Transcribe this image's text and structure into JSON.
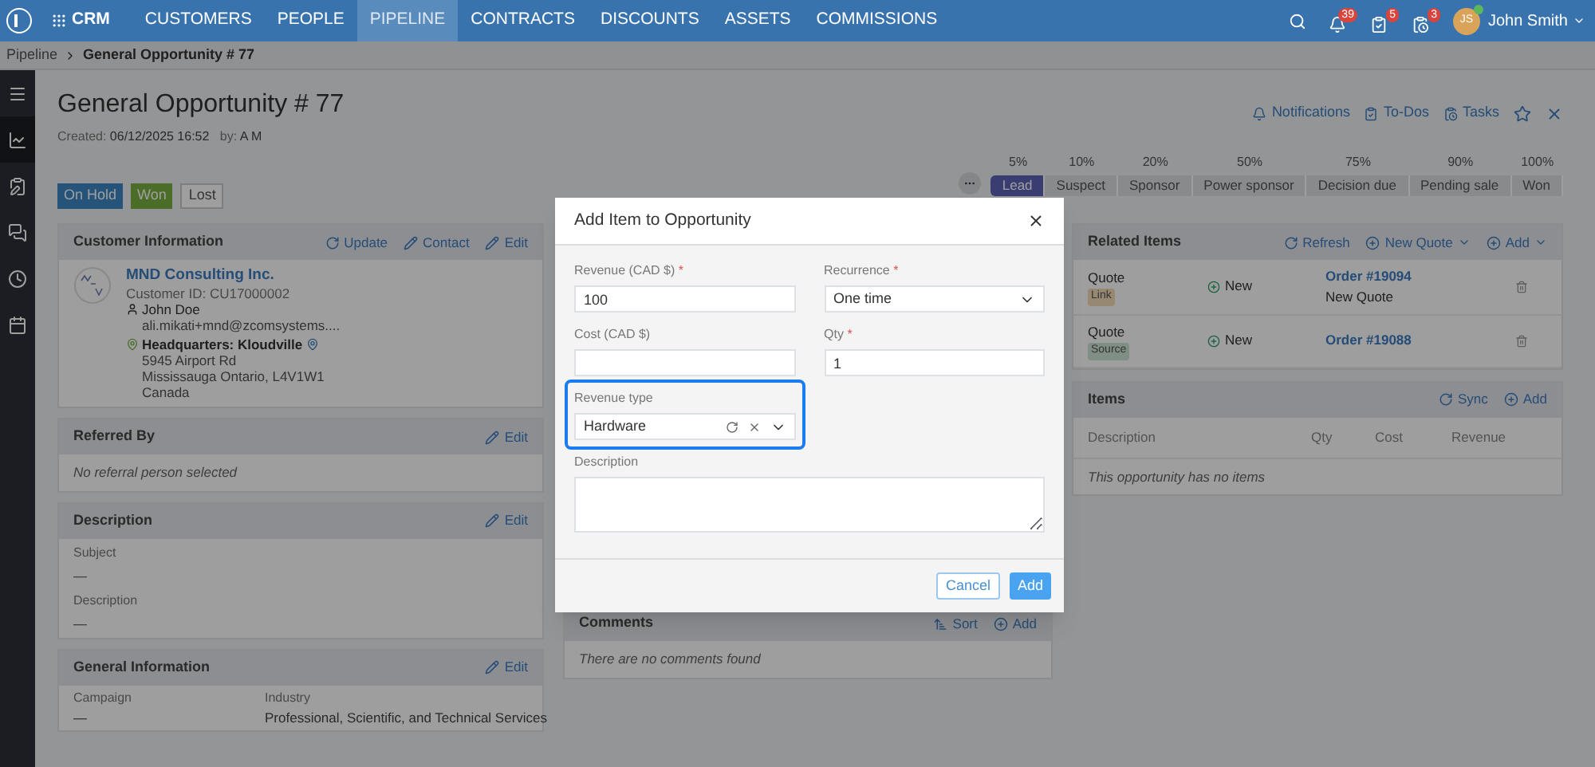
{
  "nav": {
    "app": "CRM",
    "items": [
      {
        "label": "CUSTOMERS",
        "selected": false
      },
      {
        "label": "PEOPLE",
        "selected": false
      },
      {
        "label": "PIPELINE",
        "selected": true
      },
      {
        "label": "CONTRACTS",
        "selected": false
      },
      {
        "label": "DISCOUNTS",
        "selected": false
      },
      {
        "label": "ASSETS",
        "selected": false
      },
      {
        "label": "COMMISSIONS",
        "selected": false
      }
    ],
    "badges": [
      {
        "kind": "bell",
        "count": "39"
      },
      {
        "kind": "todo",
        "count": "5"
      },
      {
        "kind": "task",
        "count": "3"
      }
    ],
    "user": {
      "initials": "JS",
      "name": "John Smith",
      "online": true
    }
  },
  "breadcrumb": [
    "Pipeline",
    "General Opportunity # 77"
  ],
  "sidebar": [
    {
      "kind": "menu",
      "selected": false
    },
    {
      "kind": "chart",
      "selected": true
    },
    {
      "kind": "clipboard",
      "selected": false
    },
    {
      "kind": "chat",
      "selected": false
    },
    {
      "kind": "clock",
      "selected": false
    },
    {
      "kind": "calendar",
      "selected": false
    }
  ],
  "header": {
    "title": "General Opportunity # 77",
    "created_label": "Created:",
    "created": "06/12/2025 16:52",
    "by_label": "by:",
    "by": "A M",
    "actions": [
      {
        "kind": "bell",
        "label": "Notifications"
      },
      {
        "kind": "todo",
        "label": "To-Dos"
      },
      {
        "kind": "task",
        "label": "Tasks"
      }
    ]
  },
  "status_buttons": [
    {
      "label": "On Hold",
      "kind": "hold"
    },
    {
      "label": "Won",
      "kind": "won"
    },
    {
      "label": "Lost",
      "kind": "lost"
    }
  ],
  "stages": [
    {
      "percent": "5%",
      "label": "Lead",
      "selected": true
    },
    {
      "percent": "10%",
      "label": "Suspect",
      "selected": false
    },
    {
      "percent": "20%",
      "label": "Sponsor",
      "selected": false
    },
    {
      "percent": "50%",
      "label": "Power sponsor",
      "selected": false
    },
    {
      "percent": "75%",
      "label": "Decision due",
      "selected": false
    },
    {
      "percent": "90%",
      "label": "Pending sale",
      "selected": false
    },
    {
      "percent": "100%",
      "label": "Won",
      "selected": false
    }
  ],
  "customer_information": {
    "title": "Customer Information",
    "actions": [
      {
        "kind": "refresh",
        "label": "Update"
      },
      {
        "kind": "edit",
        "label": "Contact"
      },
      {
        "kind": "edit",
        "label": "Edit"
      }
    ],
    "company": "MND Consulting Inc.",
    "id_label": "Customer ID:",
    "id": "CU17000002",
    "contact": "John Doe",
    "email": "ali.mikati+mnd@zcomsystems....",
    "location": "Headquarters: Kloudville",
    "address": [
      "5945 Airport Rd",
      "Mississauga Ontario, L4V1W1",
      "Canada"
    ]
  },
  "referred_by": {
    "title": "Referred By",
    "action": "Edit",
    "empty": "No referral person selected"
  },
  "description": {
    "title": "Description",
    "action": "Edit",
    "fields": [
      {
        "label": "Subject",
        "value": "—"
      },
      {
        "label": "Description",
        "value": "—"
      }
    ]
  },
  "general_information": {
    "title": "General Information",
    "action": "Edit",
    "fields": [
      {
        "label": "Campaign",
        "value": "—"
      },
      {
        "label": "Industry",
        "value": "Professional, Scientific, and Technical Services"
      }
    ]
  },
  "comments": {
    "title": "Comments",
    "actions": [
      {
        "kind": "sort",
        "label": "Sort"
      },
      {
        "kind": "add",
        "label": "Add"
      }
    ],
    "empty": "There are no comments found"
  },
  "related_items": {
    "title": "Related Items",
    "actions": [
      {
        "kind": "refresh",
        "label": "Refresh",
        "menu": false
      },
      {
        "kind": "add",
        "label": "New Quote",
        "menu": true
      },
      {
        "kind": "add",
        "label": "Add",
        "menu": true
      }
    ],
    "rows": [
      {
        "type": "Quote",
        "tag": "Link",
        "color": "#978873",
        "status": "New",
        "order": "Order #19094",
        "note": "New Quote"
      },
      {
        "type": "Quote",
        "tag": "Source",
        "color": "#808f84",
        "status": "New",
        "order": "Order #19088"
      }
    ]
  },
  "items": {
    "title": "Items",
    "actions": [
      {
        "kind": "refresh",
        "label": "Sync"
      },
      {
        "kind": "add",
        "label": "Add"
      }
    ],
    "columns": [
      "Description",
      "Qty",
      "Cost",
      "Revenue"
    ],
    "empty": "This opportunity has no items"
  },
  "dialog": {
    "title": "Add Item to Opportunity",
    "required_mark": "*",
    "fields": [
      {
        "kind": "text",
        "label": "Revenue (CAD $)",
        "required": true,
        "focused": false,
        "value": "100"
      },
      {
        "kind": "select",
        "label": "Recurrence",
        "required": true,
        "focused": false,
        "value": "One time"
      },
      {
        "kind": "text",
        "label": "Cost (CAD $)",
        "required": false,
        "focused": false
      },
      {
        "kind": "text",
        "label": "Qty",
        "required": true,
        "focused": false,
        "value": "1"
      },
      {
        "kind": "combo",
        "label": "Revenue type",
        "required": false,
        "focused": true,
        "value": "Hardware"
      },
      {
        "kind": "textarea",
        "label": "Description",
        "required": false,
        "focused": false
      }
    ],
    "buttons": [
      {
        "label": "Cancel",
        "kind": "secondary"
      },
      {
        "label": "Add",
        "kind": "primary"
      }
    ]
  }
}
